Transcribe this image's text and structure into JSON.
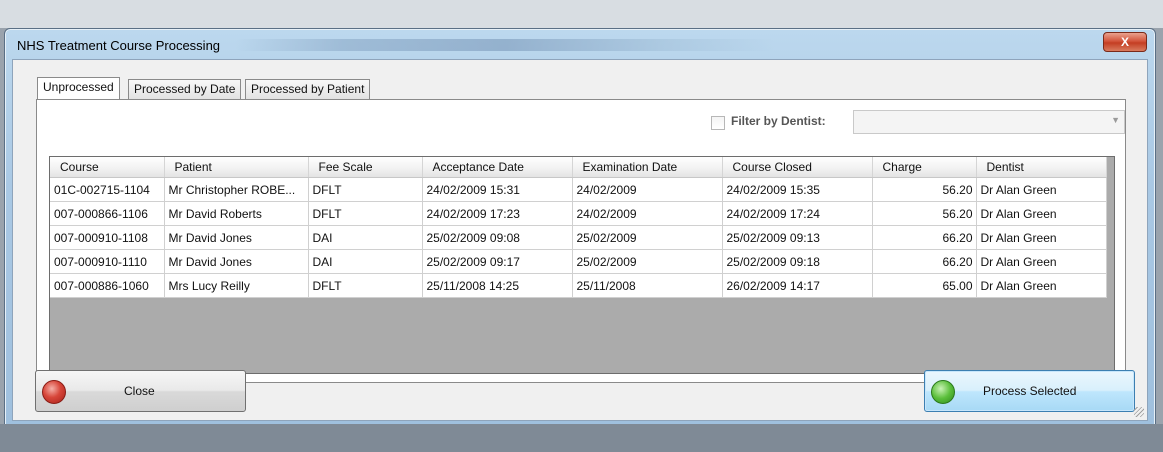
{
  "window": {
    "title": "NHS Treatment Course Processing",
    "close_glyph": "X"
  },
  "tabs": [
    {
      "label": "Unprocessed",
      "active": true
    },
    {
      "label": "Processed by Date",
      "active": false
    },
    {
      "label": "Processed by Patient",
      "active": false
    }
  ],
  "filter": {
    "label": "Filter by Dentist:",
    "checked": false,
    "selected": ""
  },
  "table": {
    "columns": [
      "Course",
      "Patient",
      "Fee Scale",
      "Acceptance Date",
      "Examination Date",
      "Course Closed",
      "Charge",
      "Dentist"
    ],
    "rows": [
      [
        "01C-002715-1104",
        "Mr Christopher ROBE...",
        "DFLT",
        "24/02/2009 15:31",
        "24/02/2009",
        "24/02/2009 15:35",
        "56.20",
        "Dr Alan Green"
      ],
      [
        "007-000866-1106",
        "Mr David Roberts",
        "DFLT",
        "24/02/2009 17:23",
        "24/02/2009",
        "24/02/2009 17:24",
        "56.20",
        "Dr Alan Green"
      ],
      [
        "007-000910-1108",
        "Mr David Jones",
        "DAI",
        "25/02/2009 09:08",
        "25/02/2009",
        "25/02/2009 09:13",
        "66.20",
        "Dr Alan Green"
      ],
      [
        "007-000910-1110",
        "Mr David Jones",
        "DAI",
        "25/02/2009 09:17",
        "25/02/2009",
        "25/02/2009 09:18",
        "66.20",
        "Dr Alan Green"
      ],
      [
        "007-000886-1060",
        "Mrs Lucy Reilly",
        "DFLT",
        "25/11/2008 14:25",
        "25/11/2008",
        "26/02/2009 14:17",
        "65.00",
        "Dr Alan Green"
      ]
    ]
  },
  "buttons": {
    "close": "Close",
    "process": "Process Selected"
  },
  "colors": {
    "selected_button_border": "#3c7fb1",
    "close_icon": "#d7463a",
    "check_icon": "#5bbf3b"
  }
}
